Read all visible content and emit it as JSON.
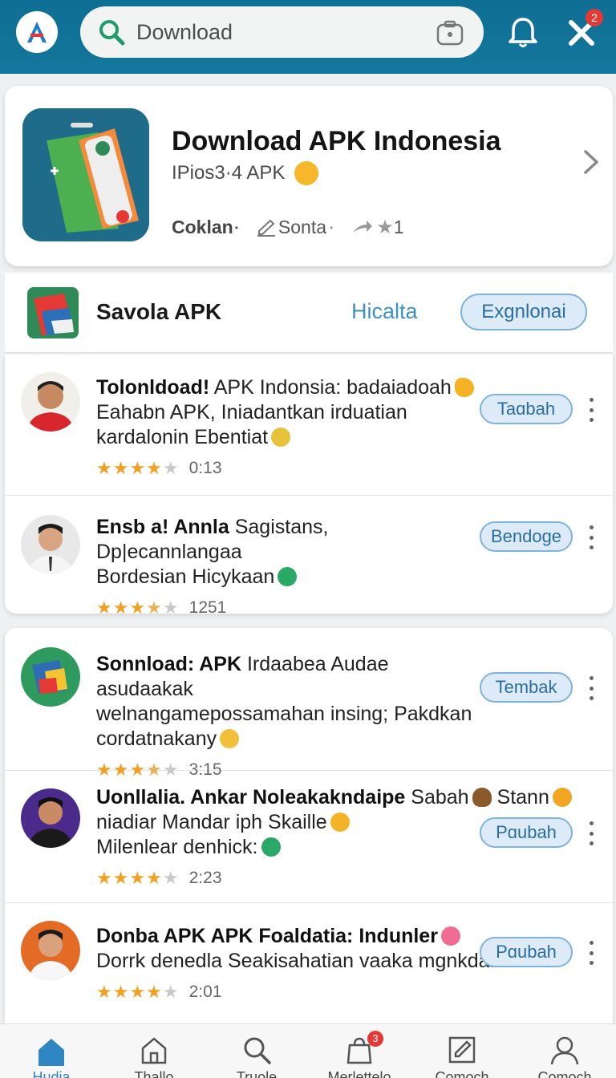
{
  "header": {
    "search_placeholder": "Download",
    "notification_count": "2"
  },
  "hero": {
    "title": "Download APK Indonesia",
    "subtitle": "IPios3·4 APK",
    "meta_author": "Coklan",
    "meta_edit": "Sonta",
    "meta_rating": "1"
  },
  "section": {
    "title": "Savola APK",
    "link_label": "Hicalta",
    "button_label": "Exgnlonai"
  },
  "cards": [
    {
      "rows": [
        {
          "title_bold": "Tolonldoad!",
          "title_rest": " APK Indonsia: badaiadoah",
          "line2": "Eahabn APK, Iniadantkan irduatian",
          "line3": "kardalonin Ebentiat",
          "stars": 4,
          "rating_text": "0:13",
          "button": "Taɑbah"
        },
        {
          "title_bold": "Ensb a! Annla",
          "title_rest": " Sagistans, Dp|ecannlangaa",
          "line2": "Bordesian Hicykaan",
          "line3": "",
          "stars": 3.5,
          "rating_text": "1251",
          "button": "Bendoge"
        }
      ]
    },
    {
      "rows": [
        {
          "title_bold": "Sonnload: APK",
          "title_rest": " Irdaabea Audae asudaakak",
          "line2": "welnangamepossamahan insing; Pakdkan",
          "line3": "cordatnakany",
          "stars": 3.5,
          "rating_text": "3:15",
          "button": "Tembak"
        },
        {
          "title_bold": "Uonllalia. Ankar Noleakakndaipe",
          "title_rest": " Sabah",
          "title_tail": " Stann",
          "line2": "niadiar Mandar iph Skaille",
          "line3": "Milenlear denhick:",
          "stars": 4,
          "rating_text": "2:23",
          "button": "Pɑubah"
        },
        {
          "title_bold": "Donba APK APK Foaldatia: Indunler",
          "title_rest": "",
          "line2": "Dorrk denedla Seakisahatian vaaka mgnkdan",
          "line3": "",
          "stars": 4,
          "rating_text": "2:01",
          "button": "Pɑubah"
        }
      ]
    }
  ],
  "bottom_nav": [
    {
      "label": "Hudia",
      "icon": "home-icon",
      "active": true
    },
    {
      "label": "Thallo",
      "icon": "home-outline-icon"
    },
    {
      "label": "Truole",
      "icon": "search-icon"
    },
    {
      "label": "Merlettelo",
      "icon": "bag-icon",
      "badge": "3"
    },
    {
      "label": "Comoch",
      "icon": "edit-icon"
    }
  ],
  "colors": {
    "topbar": "#14779c",
    "accent": "#3f90c4",
    "pill_bg": "#dcebf7",
    "star": "#f1a024"
  }
}
